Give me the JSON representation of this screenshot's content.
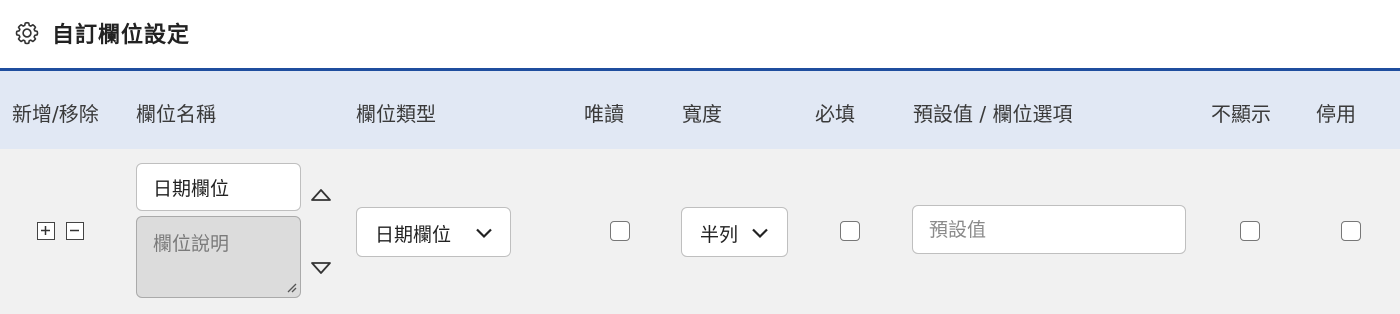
{
  "header": {
    "title": "自訂欄位設定",
    "icon": "gear-icon"
  },
  "columns": {
    "add_remove": "新增/移除",
    "field_name": "欄位名稱",
    "field_type": "欄位類型",
    "readonly": "唯讀",
    "width": "寬度",
    "required": "必填",
    "default_options": "預設值 / 欄位選項",
    "hidden": "不顯示",
    "disabled": "停用"
  },
  "row": {
    "field_name_value": "日期欄位",
    "description_placeholder": "欄位說明",
    "field_type_value": "日期欄位",
    "width_value": "半列",
    "default_placeholder": "預設值",
    "readonly_checked": false,
    "required_checked": false,
    "hidden_checked": false,
    "disabled_checked": false
  },
  "colors": {
    "accent": "#1f4e9e",
    "header_bg": "#e1e8f4",
    "row_bg": "#f1f1f1"
  }
}
